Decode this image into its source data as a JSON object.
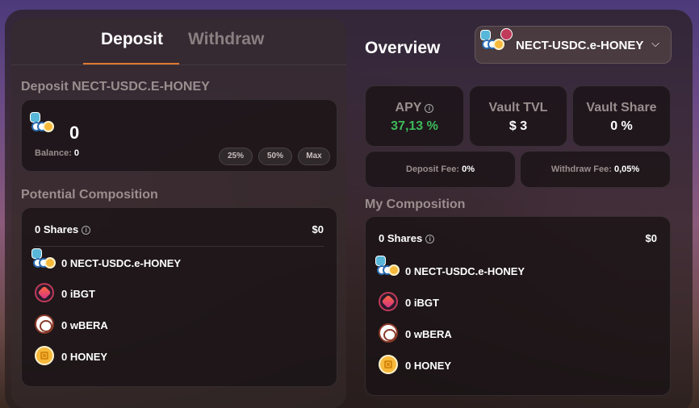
{
  "deposit_panel": {
    "tabs": [
      {
        "label": "Deposit",
        "active": true
      },
      {
        "label": "Withdraw",
        "active": false
      }
    ],
    "deposit_title": "Deposit NECT-USDC.E-HONEY",
    "amount": "0",
    "balance_label": "Balance:",
    "balance_value": "0",
    "pct_buttons": [
      "25%",
      "50%",
      "Max"
    ],
    "potential_title": "Potential Composition",
    "shares": "0 Shares",
    "shares_value": "$0",
    "tokens": [
      {
        "text": "0 NECT-USDC.e-HONEY",
        "icon": "lp-token-icon"
      },
      {
        "text": "0 iBGT",
        "icon": "ibgt-icon"
      },
      {
        "text": "0 wBERA",
        "icon": "wbera-icon"
      },
      {
        "text": "0 HONEY",
        "icon": "honey-icon"
      }
    ]
  },
  "overview": {
    "title": "Overview",
    "vault_selector": "NECT-USDC.e-HONEY",
    "apy_label": "APY",
    "apy_value": "37,13 %",
    "tvl_label": "Vault TVL",
    "tvl_value": "$ 3",
    "share_label": "Vault Share",
    "share_value": "0 %",
    "deposit_fee_label": "Deposit Fee:",
    "deposit_fee_value": "0%",
    "withdraw_fee_label": "Withdraw Fee:",
    "withdraw_fee_value": "0,05%",
    "my_title": "My Composition",
    "shares": "0 Shares",
    "shares_value": "$0",
    "tokens": [
      {
        "text": "0 NECT-USDC.e-HONEY",
        "icon": "lp-token-icon"
      },
      {
        "text": "0 iBGT",
        "icon": "ibgt-icon"
      },
      {
        "text": "0 wBERA",
        "icon": "wbera-icon"
      },
      {
        "text": "0 HONEY",
        "icon": "honey-icon"
      }
    ]
  },
  "colors": {
    "accent": "#e07a30",
    "apy_green": "#3dbb5a",
    "muted": "#9a8e8e"
  }
}
